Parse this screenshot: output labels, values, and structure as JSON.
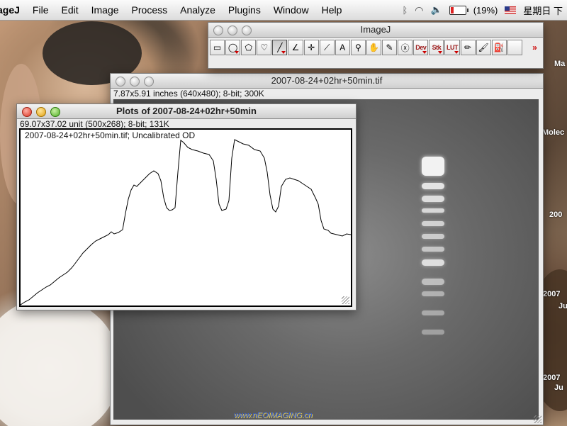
{
  "menubar": {
    "app": "ageJ",
    "items": [
      "File",
      "Edit",
      "Image",
      "Process",
      "Analyze",
      "Plugins",
      "Window",
      "Help"
    ],
    "battery": "(19%)",
    "clock": "星期日 下"
  },
  "toolbar_window": {
    "title": "ImageJ",
    "tools": [
      {
        "name": "rectangle-tool-icon",
        "glyph": "▭"
      },
      {
        "name": "oval-tool-icon",
        "glyph": "◯"
      },
      {
        "name": "polygon-tool-icon",
        "glyph": "⬠"
      },
      {
        "name": "freehand-tool-icon",
        "glyph": "♡"
      },
      {
        "name": "line-tool-icon",
        "glyph": "╱"
      },
      {
        "name": "angle-tool-icon",
        "glyph": "∠"
      },
      {
        "name": "point-tool-icon",
        "glyph": "✛"
      },
      {
        "name": "wand-tool-icon",
        "glyph": "⟋"
      },
      {
        "name": "text-tool-icon",
        "glyph": "A"
      },
      {
        "name": "magnifier-tool-icon",
        "glyph": "⚲"
      },
      {
        "name": "hand-tool-icon",
        "glyph": "✋"
      },
      {
        "name": "dropper-tool-icon",
        "glyph": "✎"
      },
      {
        "name": "close-tool-icon",
        "glyph": "ⓧ"
      },
      {
        "name": "dev-tool",
        "label": "Dev"
      },
      {
        "name": "stk-tool",
        "label": "Stk"
      },
      {
        "name": "lut-tool",
        "label": "LUT"
      },
      {
        "name": "pencil-tool-icon",
        "glyph": "✏"
      },
      {
        "name": "brush-tool-icon",
        "glyph": "🖌"
      },
      {
        "name": "flood-fill-tool-icon",
        "glyph": "⛽"
      },
      {
        "name": "blank-tool",
        "glyph": ""
      }
    ],
    "more": "»"
  },
  "image_window": {
    "title": "2007-08-24+02hr+50min.tif",
    "info": "7.87x5.91 inches (640x480); 8-bit; 300K",
    "watermark": "www.nEOIMAGING.cn"
  },
  "plot_window": {
    "title": "Plots of 2007-08-24+02hr+50min",
    "info": "69.07x37.02 unit (500x268); 8-bit; 131K",
    "label": "2007-08-24+02hr+50min.tif; Uncalibrated OD"
  },
  "desktop_labels": [
    "Ma",
    "Molec",
    "200",
    "2007",
    "Ju",
    "2007",
    "Ju"
  ],
  "gel_bands": [
    {
      "y": 0.18,
      "h": 0.06,
      "b": 1.0
    },
    {
      "y": 0.26,
      "h": 0.02,
      "b": 0.9
    },
    {
      "y": 0.3,
      "h": 0.02,
      "b": 0.85
    },
    {
      "y": 0.34,
      "h": 0.015,
      "b": 0.8
    },
    {
      "y": 0.38,
      "h": 0.015,
      "b": 0.75
    },
    {
      "y": 0.42,
      "h": 0.015,
      "b": 0.7
    },
    {
      "y": 0.46,
      "h": 0.015,
      "b": 0.65
    },
    {
      "y": 0.5,
      "h": 0.02,
      "b": 0.85
    },
    {
      "y": 0.56,
      "h": 0.02,
      "b": 0.6
    },
    {
      "y": 0.6,
      "h": 0.015,
      "b": 0.5
    },
    {
      "y": 0.66,
      "h": 0.015,
      "b": 0.45
    },
    {
      "y": 0.72,
      "h": 0.015,
      "b": 0.4
    }
  ]
}
